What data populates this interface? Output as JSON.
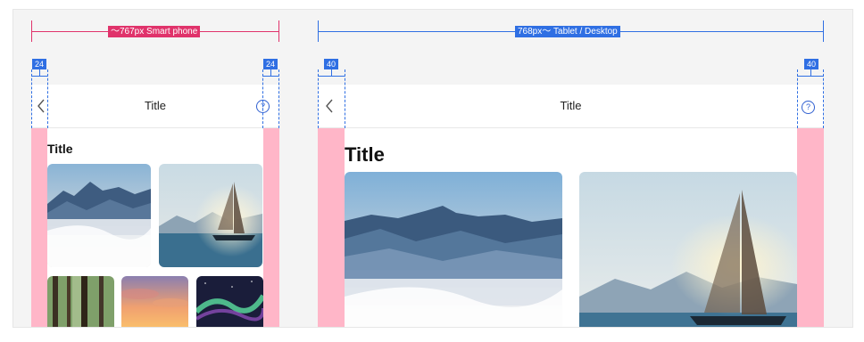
{
  "sp": {
    "range_label": "〜767px  Smart phone",
    "margin_left": "24",
    "margin_right": "24",
    "header_title": "Title",
    "page_title": "Title",
    "accent": "#e0336b"
  },
  "tablet": {
    "range_label": "768px〜  Tablet / Desktop",
    "margin_left": "40",
    "margin_right": "40",
    "header_title": "Title",
    "page_title": "Title",
    "accent": "#2f6fe3"
  },
  "icons": {
    "back": "chevron-left-icon",
    "help": "question-circle-icon",
    "help_glyph": "?"
  },
  "gutter_color": "#ffb6c8"
}
